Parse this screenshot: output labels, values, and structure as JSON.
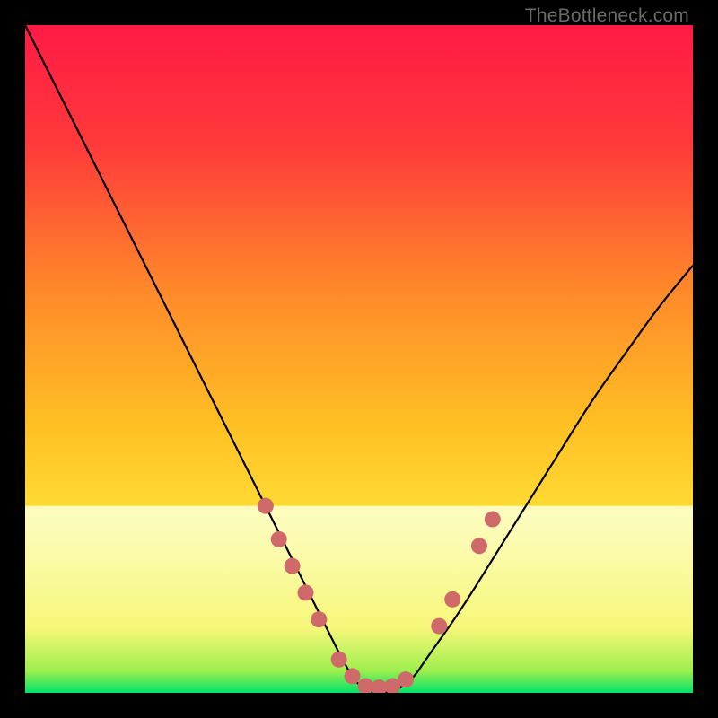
{
  "watermark": "TheBottleneck.com",
  "chart_data": {
    "type": "line",
    "title": "",
    "xlabel": "",
    "ylabel": "",
    "xlim": [
      0,
      100
    ],
    "ylim": [
      0,
      100
    ],
    "grid": false,
    "legend": false,
    "series": [
      {
        "name": "bottleneck-curve",
        "x": [
          0,
          5,
          10,
          15,
          20,
          25,
          30,
          35,
          40,
          45,
          48,
          50,
          52,
          55,
          58,
          60,
          65,
          70,
          75,
          80,
          85,
          90,
          95,
          100
        ],
        "values": [
          100,
          90,
          80,
          70,
          60,
          50,
          40,
          30,
          20,
          10,
          4,
          1,
          0,
          0,
          2,
          5,
          12,
          20,
          28,
          36,
          44,
          51,
          58,
          64
        ]
      }
    ],
    "optimal_zone": {
      "y_start": 0,
      "y_end": 28,
      "gradient_stops": [
        {
          "offset": 0.0,
          "color": "#00e36a"
        },
        {
          "offset": 0.12,
          "color": "#9fef4e"
        },
        {
          "offset": 0.35,
          "color": "#f7f77a"
        },
        {
          "offset": 0.8,
          "color": "#fbfbb0"
        },
        {
          "offset": 1.0,
          "color": "#fcfcc0"
        }
      ]
    },
    "markers": {
      "name": "curve-dot-markers",
      "color": "#cf6a6a",
      "radius_px": 9,
      "points": [
        {
          "x": 36,
          "y": 28
        },
        {
          "x": 38,
          "y": 23
        },
        {
          "x": 40,
          "y": 19
        },
        {
          "x": 42,
          "y": 15
        },
        {
          "x": 44,
          "y": 11
        },
        {
          "x": 47,
          "y": 5
        },
        {
          "x": 49,
          "y": 2.5
        },
        {
          "x": 51,
          "y": 1
        },
        {
          "x": 53,
          "y": 0.8
        },
        {
          "x": 55,
          "y": 1
        },
        {
          "x": 57,
          "y": 2
        },
        {
          "x": 62,
          "y": 10
        },
        {
          "x": 64,
          "y": 14
        },
        {
          "x": 68,
          "y": 22
        },
        {
          "x": 70,
          "y": 26
        }
      ]
    },
    "background_gradient": [
      {
        "offset": 0.0,
        "color": "#ff1a46"
      },
      {
        "offset": 0.18,
        "color": "#ff3a3a"
      },
      {
        "offset": 0.4,
        "color": "#ff8a2a"
      },
      {
        "offset": 0.6,
        "color": "#ffc024"
      },
      {
        "offset": 0.78,
        "color": "#ffe63a"
      },
      {
        "offset": 0.92,
        "color": "#faf87a"
      },
      {
        "offset": 1.0,
        "color": "#f7f7a8"
      }
    ]
  }
}
